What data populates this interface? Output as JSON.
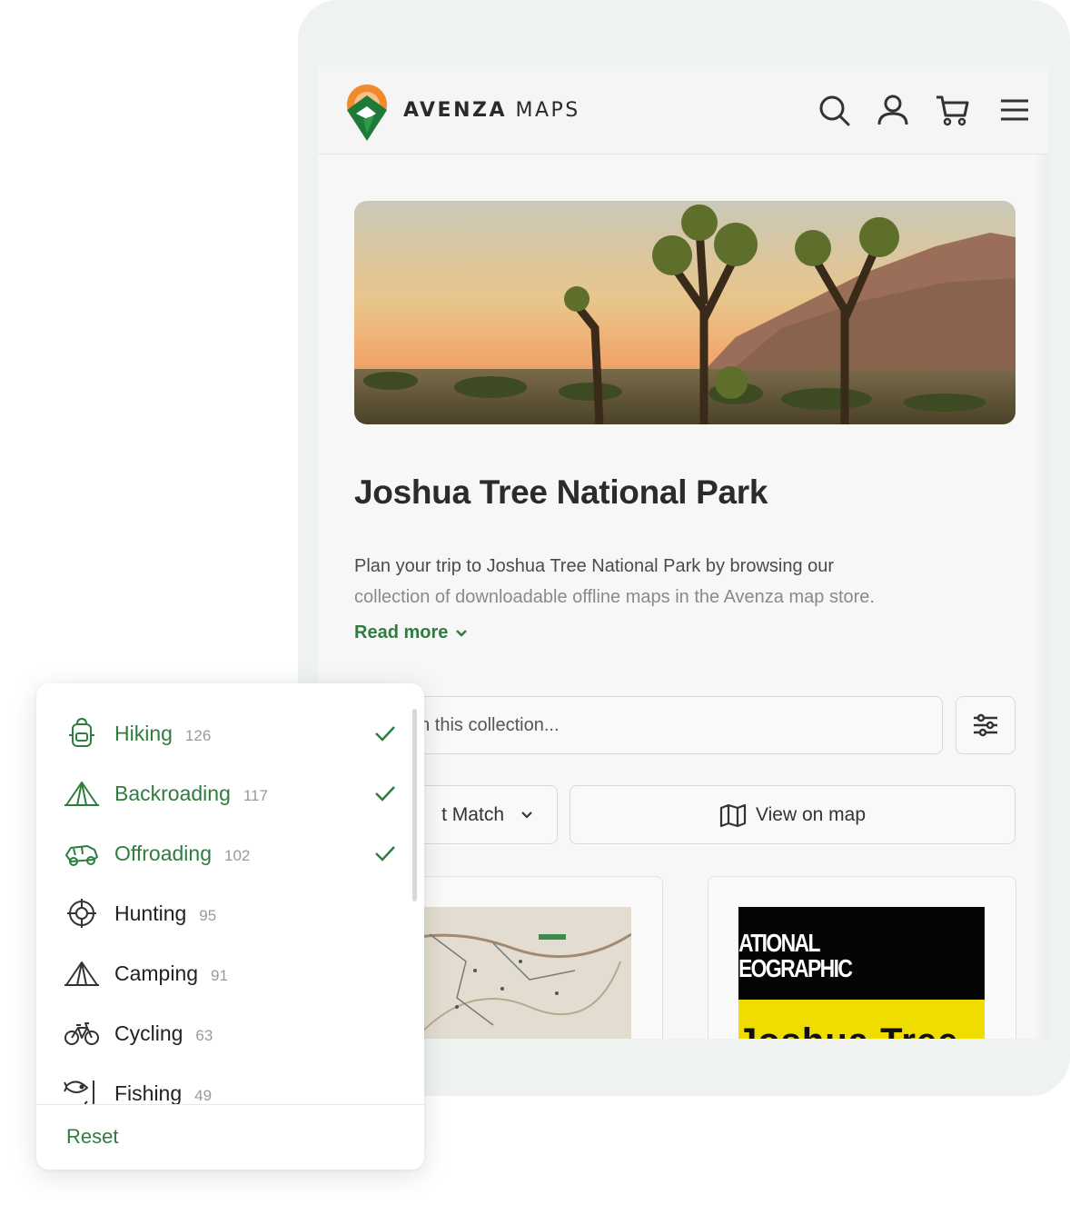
{
  "app": {
    "brand_bold": "AVENZA",
    "brand_light": " MAPS"
  },
  "header": {
    "icons": [
      "search-icon",
      "user-icon",
      "cart-icon",
      "menu-icon"
    ]
  },
  "page": {
    "title": "Joshua Tree National Park",
    "description_line1": "Plan your trip to Joshua Tree National Park by browsing our",
    "description_line2": "collection of downloadable offline maps in the Avenza map store.",
    "read_more": "Read more"
  },
  "controls": {
    "search_placeholder": "ch in this collection...",
    "sort_label": "t Match",
    "view_on_map": "View on map"
  },
  "cards": {
    "natgeo_line1": "ATIONAL",
    "natgeo_line2": "EOGRAPHIC",
    "natgeo_title": "Joshua Tree"
  },
  "filter": {
    "options": [
      {
        "label": "Hiking",
        "count": "126",
        "selected": true,
        "icon": "backpack-icon"
      },
      {
        "label": "Backroading",
        "count": "117",
        "selected": true,
        "icon": "tent-icon"
      },
      {
        "label": "Offroading",
        "count": "102",
        "selected": true,
        "icon": "offroad-vehicle-icon"
      },
      {
        "label": "Hunting",
        "count": "95",
        "selected": false,
        "icon": "crosshair-icon"
      },
      {
        "label": "Camping",
        "count": "91",
        "selected": false,
        "icon": "tent-icon"
      },
      {
        "label": "Cycling",
        "count": "63",
        "selected": false,
        "icon": "bicycle-icon"
      },
      {
        "label": "Fishing",
        "count": "49",
        "selected": false,
        "icon": "fish-hook-icon"
      }
    ],
    "reset": "Reset"
  },
  "colors": {
    "accent_green": "#2e7d3e",
    "frame_bg": "#eef3f1",
    "logo_orange": "#e8792b"
  }
}
